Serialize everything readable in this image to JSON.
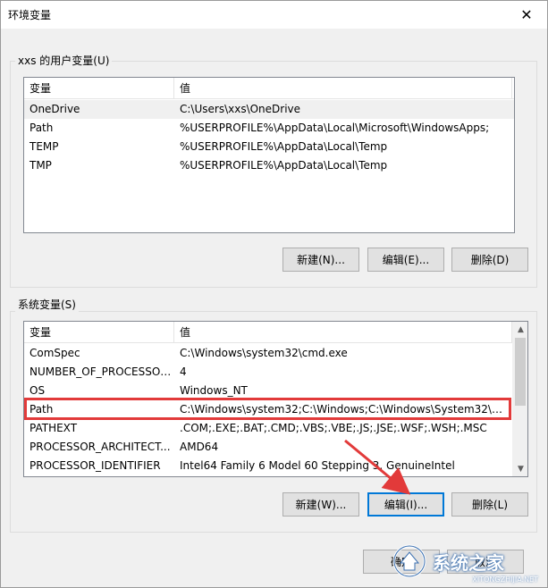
{
  "window": {
    "title": "环境变量",
    "close_glyph": "✕"
  },
  "user_vars": {
    "group_label": "xxs 的用户变量(U)",
    "columns": [
      "变量",
      "值"
    ],
    "rows": [
      {
        "name": "OneDrive",
        "value": "C:\\Users\\xxs\\OneDrive"
      },
      {
        "name": "Path",
        "value": "%USERPROFILE%\\AppData\\Local\\Microsoft\\WindowsApps;"
      },
      {
        "name": "TEMP",
        "value": "%USERPROFILE%\\AppData\\Local\\Temp"
      },
      {
        "name": "TMP",
        "value": "%USERPROFILE%\\AppData\\Local\\Temp"
      }
    ],
    "buttons": {
      "new": "新建(N)...",
      "edit": "编辑(E)...",
      "delete": "删除(D)"
    }
  },
  "system_vars": {
    "group_label": "系统变量(S)",
    "columns": [
      "变量",
      "值"
    ],
    "rows": [
      {
        "name": "ComSpec",
        "value": "C:\\Windows\\system32\\cmd.exe"
      },
      {
        "name": "NUMBER_OF_PROCESSORS",
        "value": "4"
      },
      {
        "name": "OS",
        "value": "Windows_NT"
      },
      {
        "name": "Path",
        "value": "C:\\Windows\\system32;C:\\Windows;C:\\Windows\\System32\\Wb..."
      },
      {
        "name": "PATHEXT",
        "value": ".COM;.EXE;.BAT;.CMD;.VBS;.VBE;.JS;.JSE;.WSF;.WSH;.MSC"
      },
      {
        "name": "PROCESSOR_ARCHITECT...",
        "value": "AMD64"
      },
      {
        "name": "PROCESSOR_IDENTIFIER",
        "value": "Intel64 Family 6 Model 60 Stepping 3, GenuineIntel"
      }
    ],
    "buttons": {
      "new": "新建(W)...",
      "edit": "编辑(I)...",
      "delete": "删除(L)"
    }
  },
  "footer": {
    "ok": "确定",
    "cancel": "取消"
  },
  "watermark": {
    "text": "系统之家",
    "sub": "XITONGZHIJIA.NET"
  },
  "colors": {
    "highlight": "#e23a3a",
    "focus": "#0078d7"
  }
}
